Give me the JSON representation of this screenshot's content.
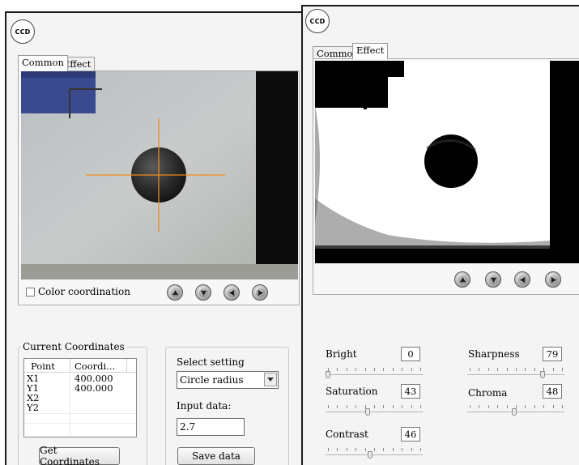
{
  "left_window": {
    "logo_text": "CCD",
    "tabs": [
      {
        "label": "Common",
        "active": true
      },
      {
        "label": "Effect",
        "active": false
      }
    ],
    "color_coordination_label": "Color coordination",
    "color_coordination_checked": false,
    "nav_buttons": [
      "up-arrow-icon",
      "down-arrow-icon",
      "left-arrow-icon",
      "right-arrow-icon"
    ],
    "coordinates_group_title": "Current Coordinates",
    "coordinates_table": {
      "columns": [
        "Point",
        "Coordi..."
      ],
      "rows": [
        {
          "point": "X1",
          "value": "400.000"
        },
        {
          "point": "Y1",
          "value": "400.000"
        },
        {
          "point": "X2",
          "value": ""
        },
        {
          "point": "Y2",
          "value": ""
        }
      ]
    },
    "get_coordinates_button": "Get Coordinates",
    "select_setting_label": "Select setting",
    "select_setting_value": "Circle radius",
    "input_data_label": "Input data:",
    "input_data_value": "2.7",
    "save_data_button": "Save data"
  },
  "right_window": {
    "logo_text": "CCD",
    "tabs": [
      {
        "label": "Common",
        "active": false
      },
      {
        "label": "Effect",
        "active": true
      }
    ],
    "nav_buttons": [
      "up-arrow-icon",
      "down-arrow-icon",
      "left-arrow-icon",
      "right-arrow-icon"
    ],
    "sliders": [
      {
        "label": "Bright",
        "value": "0",
        "level": 0.0
      },
      {
        "label": "Sharpness",
        "value": "79",
        "level": 0.79
      },
      {
        "label": "Saturation",
        "value": "43",
        "level": 0.43
      },
      {
        "label": "Chroma",
        "value": "48",
        "level": 0.48
      },
      {
        "label": "Contrast",
        "value": "46",
        "level": 0.46
      }
    ]
  },
  "colors": {
    "crosshair": "#f08a1e",
    "window_bg": "#f4f4f4",
    "camera_dark": "#0a0a0a"
  }
}
